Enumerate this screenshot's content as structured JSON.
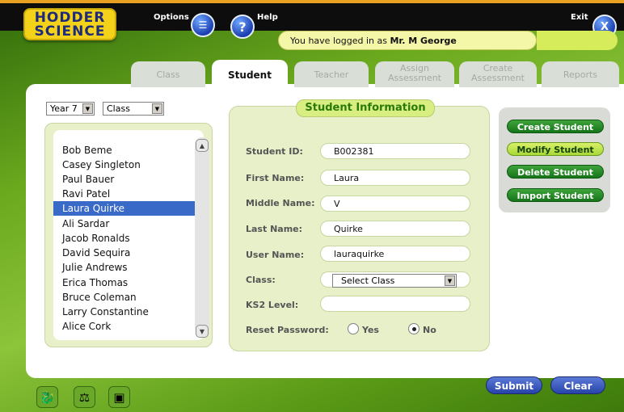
{
  "logo": {
    "line1": "HODDER",
    "line2": "SCIENCE"
  },
  "header": {
    "options_label": "Options",
    "help_label": "Help",
    "exit_label": "Exit",
    "help_glyph": "?",
    "exit_glyph": "X",
    "login_prefix": "You have logged in as ",
    "login_user": "Mr. M George"
  },
  "tabs": [
    {
      "label": "Class"
    },
    {
      "label": "Student",
      "active": true
    },
    {
      "label": "Teacher"
    },
    {
      "label_line1": "Assign",
      "label_line2": "Assessment"
    },
    {
      "label_line1": "Create",
      "label_line2": "Assessment"
    },
    {
      "label": "Reports"
    }
  ],
  "filters": {
    "year": "Year 7",
    "class": "Class"
  },
  "students": [
    "Bob Beme",
    "Casey Singleton",
    "Paul Bauer",
    "Ravi Patel",
    "Laura Quirke",
    "Ali Sardar",
    "Jacob Ronalds",
    "David Sequira",
    "Julie Andrews",
    "Erica Thomas",
    "Bruce Coleman",
    "Larry Constantine",
    "Alice Cork"
  ],
  "selected_student": "Laura Quirke",
  "info": {
    "title": "Student Information",
    "student_id": {
      "label": "Student ID:",
      "value": "B002381"
    },
    "first_name": {
      "label": "First Name:",
      "value": "Laura"
    },
    "middle_name": {
      "label": "Middle Name:",
      "value": "V"
    },
    "last_name": {
      "label": "Last Name:",
      "value": "Quirke"
    },
    "user_name": {
      "label": "User Name:",
      "value": "lauraquirke"
    },
    "class": {
      "label": "Class:",
      "value": "Select Class"
    },
    "ks2": {
      "label": "KS2 Level:",
      "value": ""
    },
    "reset": {
      "label": "Reset Password:",
      "yes": "Yes",
      "no": "No",
      "selected": "No"
    }
  },
  "actions": {
    "create": "Create Student",
    "modify": "Modify Student",
    "delete": "Delete Student",
    "import": "Import Student"
  },
  "footer": {
    "submit": "Submit",
    "clear": "Clear"
  },
  "icons": [
    "options-list-icon",
    "help-icon",
    "exit-icon",
    "dropdown-arrow-icon",
    "scroll-up-icon",
    "scroll-down-icon",
    "dragon-icon",
    "flask-icon",
    "book-icon"
  ],
  "colors": {
    "brand_yellow": "#f4d21a",
    "accent_green": "#2a7a0a",
    "select_blue": "#3a6ac8",
    "button_blue": "#2843a8"
  }
}
